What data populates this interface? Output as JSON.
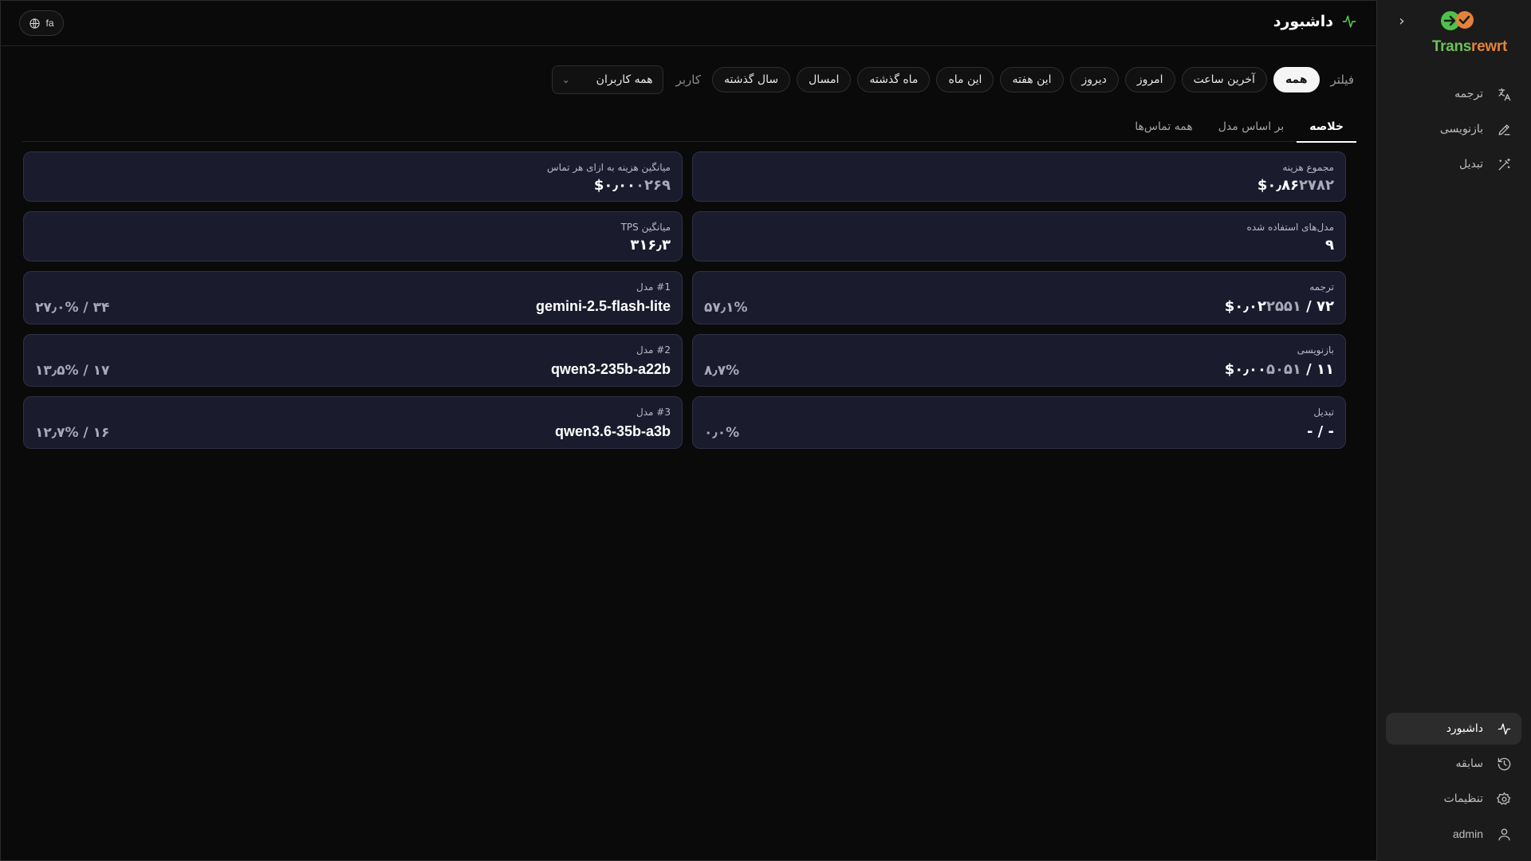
{
  "app": {
    "logo_part1": "Trans",
    "logo_part2": "rewrt",
    "accent_green": "#4ec24a",
    "accent_orange": "#e5823a"
  },
  "sidebar": {
    "collapse_icon": "chevron-right-icon",
    "top_items": [
      {
        "label": "ترجمه",
        "icon": "translate-icon"
      },
      {
        "label": "بازنویسی",
        "icon": "pen-icon"
      },
      {
        "label": "تبدیل",
        "icon": "magic-wand-icon"
      }
    ],
    "bottom_items": [
      {
        "label": "داشبورد",
        "icon": "activity-icon",
        "active": true
      },
      {
        "label": "سابقه",
        "icon": "history-icon"
      },
      {
        "label": "تنظیمات",
        "icon": "gear-icon"
      },
      {
        "label": "admin",
        "icon": "user-icon"
      }
    ]
  },
  "header": {
    "title": "داشبورد",
    "lang": "fa"
  },
  "filters": {
    "label": "فیلتر",
    "chips": [
      "همه",
      "آخرین ساعت",
      "امروز",
      "دیروز",
      "این هفته",
      "این ماه",
      "ماه گذشته",
      "امسال",
      "سال گذشته"
    ],
    "active_chip": "همه",
    "user_label": "کاربر",
    "user_value": "همه کاربران"
  },
  "tabs": [
    "خلاصه",
    "بر اساس مدل",
    "همه تماس‌ها"
  ],
  "active_tab": "خلاصه",
  "cards": {
    "total_cost": {
      "label": "مجموع هزینه",
      "value": "$۰٫۸۶",
      "value_muted": "۲۷۸۲"
    },
    "avg_cost": {
      "label": "میانگین هزینه به ازای هر تماس",
      "value": "$۰٫۰۰",
      "value_muted": "۰۲۶۹"
    },
    "models_used": {
      "label": "مدل‌های استفاده شده",
      "value": "۹"
    },
    "avg_tps": {
      "label": "میانگین TPS",
      "value": "۳۱۶٫۳"
    },
    "translate": {
      "label": "ترجمه",
      "value": "۷۲ / $۰٫۰۲",
      "value_muted": "۲۵۵۱",
      "percent": "۵۷٫۱%"
    },
    "rewrite": {
      "label": "بازنویسی",
      "value": "۱۱ / $۰٫۰۰",
      "value_muted": "۵۰۵۱",
      "percent": "۸٫۷%"
    },
    "convert": {
      "label": "تبدیل",
      "value": "- / -",
      "percent": "۰٫۰%"
    },
    "model1": {
      "label": "#1 مدل",
      "name": "gemini-2.5-flash-lite",
      "stat": "۳۴ / ۲۷٫۰%"
    },
    "model2": {
      "label": "#2 مدل",
      "name": "qwen3-235b-a22b",
      "stat": "۱۷ / ۱۳٫۵%"
    },
    "model3": {
      "label": "#3 مدل",
      "name": "qwen3.6-35b-a3b",
      "stat": "۱۶ / ۱۲٫۷%"
    }
  }
}
